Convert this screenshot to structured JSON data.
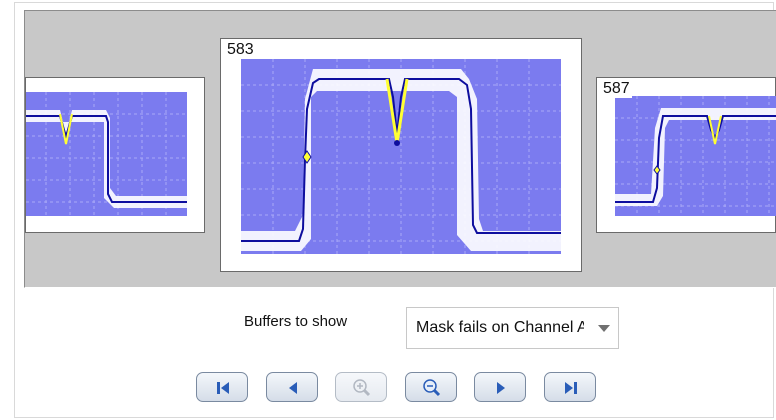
{
  "thumbnails": [
    {
      "label": "",
      "role": "previous"
    },
    {
      "label": "583",
      "role": "selected"
    },
    {
      "label": "587",
      "role": "next"
    }
  ],
  "controls": {
    "buffers_label": "Buffers to show",
    "buffers_value": "Mask fails on Channel A"
  },
  "navigation": {
    "first": "first-buffer-icon",
    "previous": "previous-buffer-icon",
    "zoom_in": "zoom-in-icon",
    "zoom_out": "zoom-out-icon",
    "next": "next-buffer-icon",
    "last": "last-buffer-icon",
    "zoom_in_enabled": false
  },
  "colors": {
    "mask": "#7b7bef",
    "trace": "#0d0d9e",
    "fail": "#ffff33",
    "nav_glyph": "#2a5db8"
  }
}
